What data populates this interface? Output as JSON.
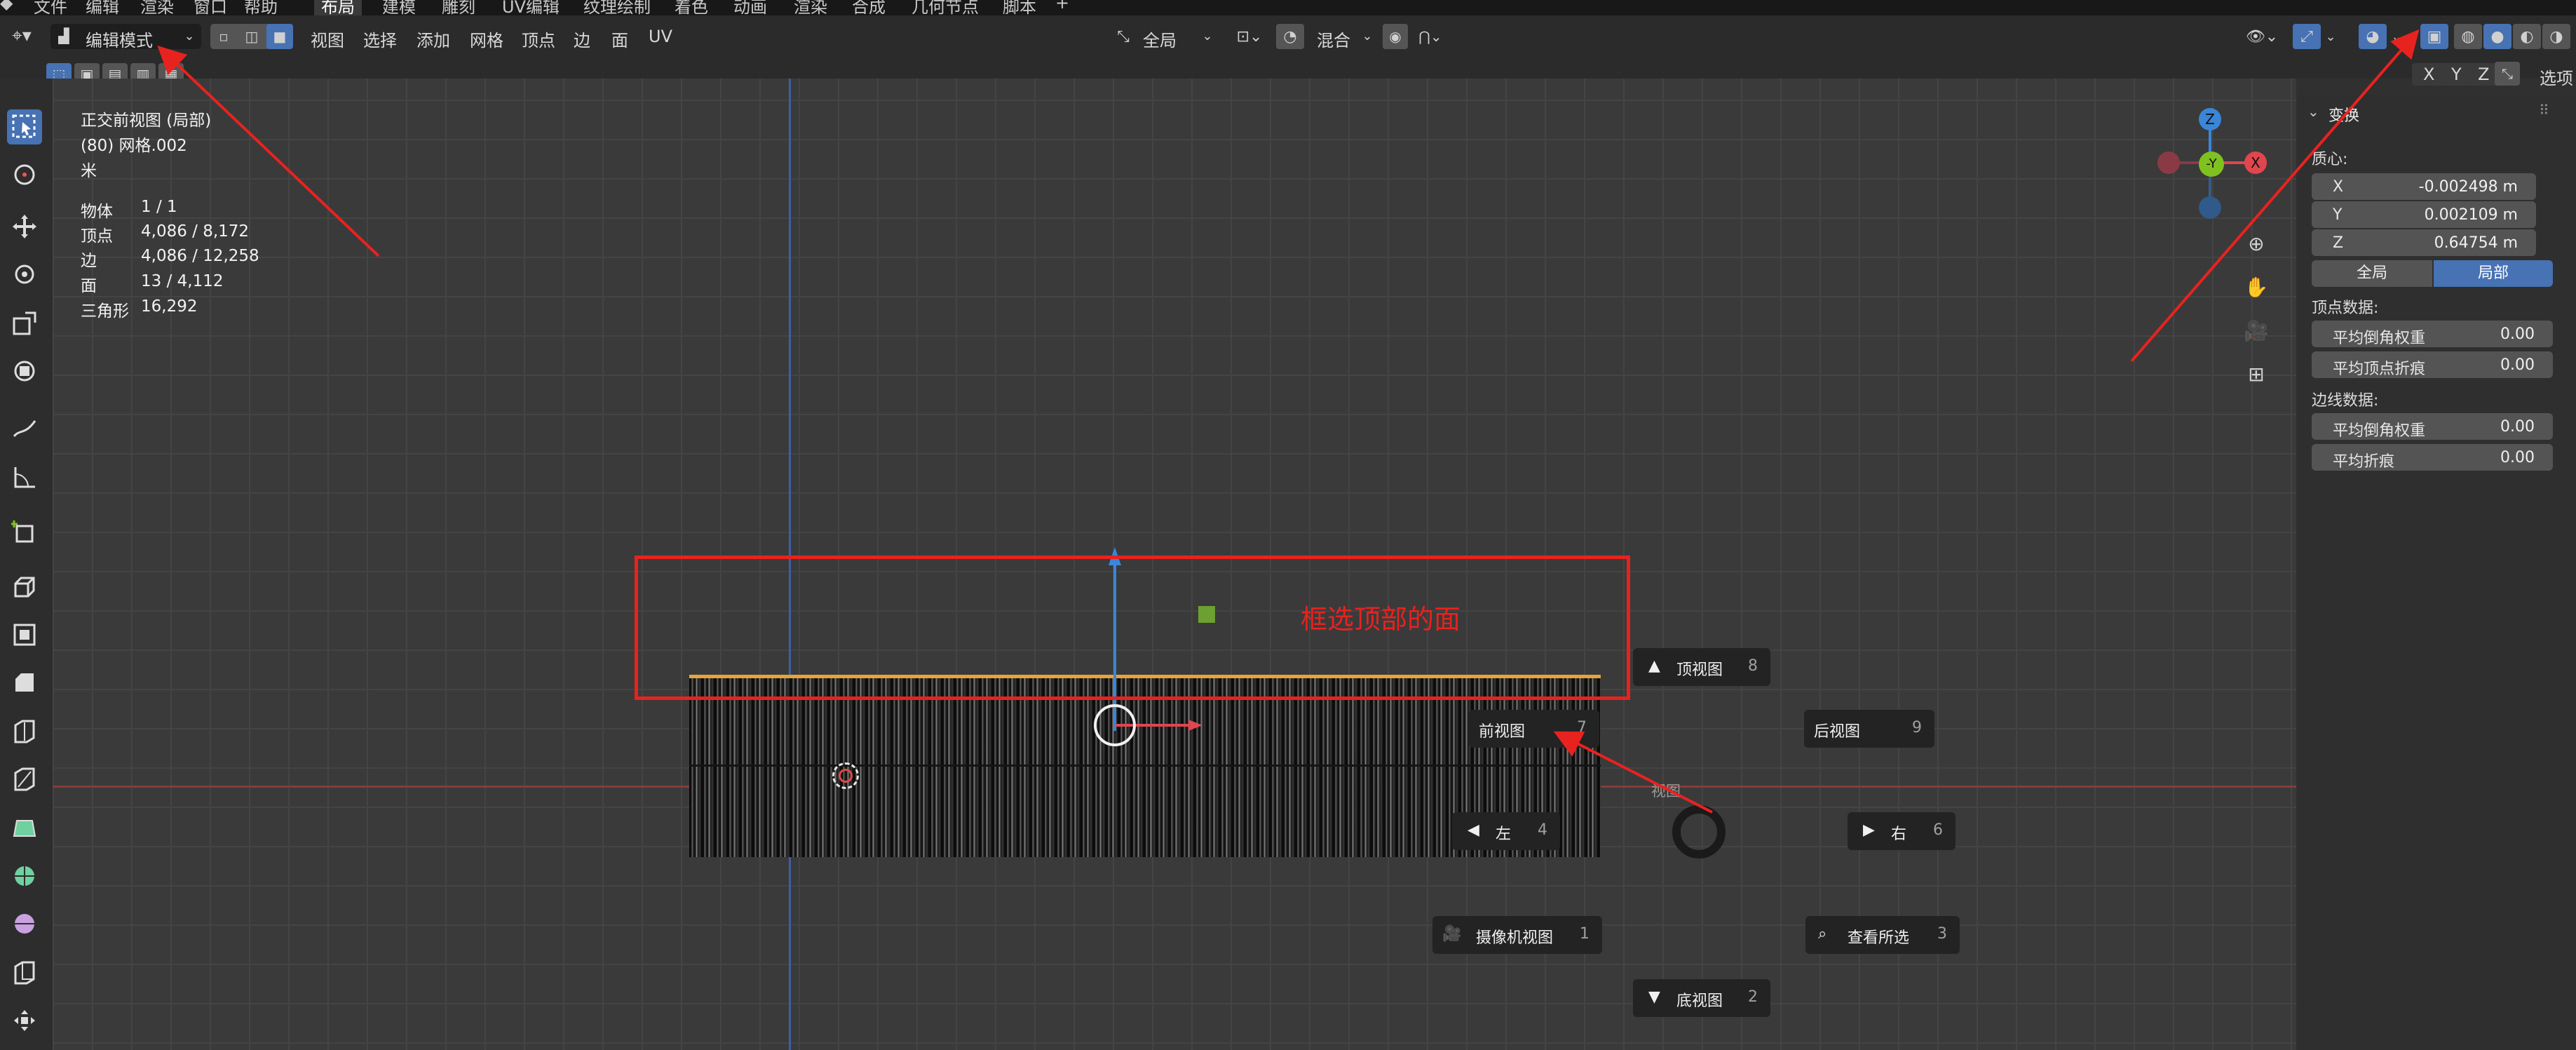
{
  "top_menu": {
    "items": [
      "文件",
      "编辑",
      "渲染",
      "窗口",
      "帮助"
    ],
    "workspaces": [
      "布局",
      "建模",
      "雕刻",
      "UV编辑",
      "纹理绘制",
      "着色",
      "动画",
      "渲染",
      "合成",
      "几何节点",
      "脚本"
    ],
    "add_tab": "+"
  },
  "header": {
    "mode": "编辑模式",
    "menus": [
      "视图",
      "选择",
      "添加",
      "网格",
      "顶点",
      "边",
      "面",
      "UV"
    ],
    "orientation": "全局",
    "proportional": "混合",
    "options": "选项",
    "axes": [
      "X",
      "Y",
      "Z"
    ]
  },
  "overlay_info": {
    "view_name": "正交前视图 (局部)",
    "object_name": "(80) 网格.002",
    "unit": "米",
    "stats": [
      {
        "label": "物体",
        "value": "1 / 1"
      },
      {
        "label": "顶点",
        "value": "4,086 / 8,172"
      },
      {
        "label": "边",
        "value": "4,086 / 12,258"
      },
      {
        "label": "面",
        "value": "13 / 4,112"
      },
      {
        "label": "三角形",
        "value": "16,292"
      }
    ]
  },
  "gizmo": {
    "z": "Z",
    "y": "-Y",
    "x": "X"
  },
  "annotation": {
    "text": "框选顶部的面",
    "color": "#e8221f"
  },
  "pie_menu": {
    "title": "视图",
    "items": [
      {
        "label": "顶视图",
        "key": "8"
      },
      {
        "label": "前视图",
        "key": "7"
      },
      {
        "label": "后视图",
        "key": "9"
      },
      {
        "label": "左",
        "key": "4"
      },
      {
        "label": "右",
        "key": "6"
      },
      {
        "label": "摄像机视图",
        "key": "1"
      },
      {
        "label": "查看所选",
        "key": "3"
      },
      {
        "label": "底视图",
        "key": "2"
      }
    ]
  },
  "n_panel": {
    "title": "变换",
    "median_label": "质心:",
    "median": [
      {
        "axis": "X",
        "value": "-0.002498 m"
      },
      {
        "axis": "Y",
        "value": "0.002109 m"
      },
      {
        "axis": "Z",
        "value": "0.64754 m"
      }
    ],
    "space_tabs": [
      "全局",
      "局部"
    ],
    "active_space": "局部",
    "vertex_data_label": "顶点数据:",
    "vertex_data": [
      {
        "label": "平均倒角权重",
        "value": "0.00"
      },
      {
        "label": "平均顶点折痕",
        "value": "0.00"
      }
    ],
    "edge_data_label": "边线数据:",
    "edge_data": [
      {
        "label": "平均倒角权重",
        "value": "0.00"
      },
      {
        "label": "平均折痕",
        "value": "0.00"
      }
    ]
  },
  "colors": {
    "accent": "#4772b3",
    "annotation_red": "#e8221f",
    "axis_x": "#e0464f",
    "axis_y": "#7fc120",
    "axis_z": "#3a86d8"
  }
}
